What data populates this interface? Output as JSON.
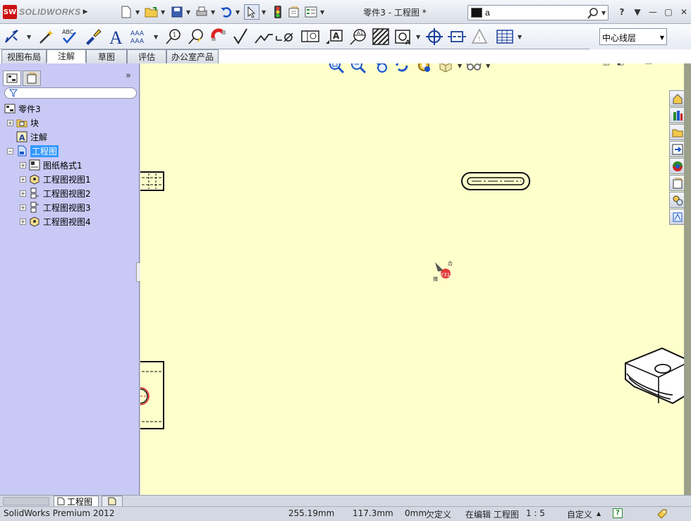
{
  "app": {
    "logo_text": "SOLIDWORKS",
    "window_title": "零件3 - 工程图 *"
  },
  "search": {
    "value": "a"
  },
  "layer": {
    "selected": "中心线层"
  },
  "command_tabs": [
    "视图布局",
    "注解",
    "草图",
    "评估",
    "办公室产品"
  ],
  "feature_tree": {
    "root": "零件3",
    "items": [
      {
        "label": "块",
        "level": 1
      },
      {
        "label": "注解",
        "level": 1
      },
      {
        "label": "工程图",
        "level": 1
      },
      {
        "label": "图纸格式1",
        "level": 2
      },
      {
        "label": "工程图视图1",
        "level": 2
      },
      {
        "label": "工程图视图2",
        "level": 2
      },
      {
        "label": "工程图视图3",
        "level": 2
      },
      {
        "label": "工程图视图4",
        "level": 2
      }
    ]
  },
  "sheet_tab": {
    "label": "工程图"
  },
  "status": {
    "product": "SolidWorks Premium 2012",
    "x": "255.19mm",
    "y": "117.3mm",
    "z": "0mm",
    "state": "欠定义",
    "editing": "在编辑 工程图",
    "scale": "1 : 5",
    "units": "自定义"
  },
  "colors": {
    "canvas": "#ffffcc",
    "panel": "#c9c9f5",
    "selection": "#3399ff"
  }
}
